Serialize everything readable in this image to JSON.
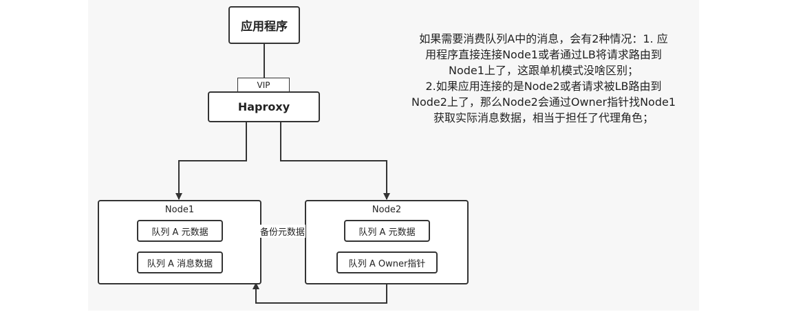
{
  "diagram": {
    "app_node": "应用程序",
    "vip_label": "VIP",
    "haproxy_node": "Haproxy",
    "node1": {
      "title": "Node1",
      "metadata_box": "队列 A 元数据",
      "message_box": "队列 A 消息数据"
    },
    "node2": {
      "title": "Node2",
      "metadata_box": "队列 A 元数据",
      "owner_box": "队列 A Owner指针"
    },
    "backup_edge_label": "备份元数据"
  },
  "note": {
    "lines": [
      "如果需要消费队列A中的消息，会有2种情况：1. 应",
      "用程序直接连接Node1或者通过LB将请求路由到",
      "Node1上了，这跟单机模式没啥区别；",
      "2.如果应用连接的是Node2或者请求被LB路由到",
      "Node2上了，那么Node2会通过Owner指针找Node1",
      "获取实际消息数据，相当于担任了代理角色；"
    ]
  }
}
